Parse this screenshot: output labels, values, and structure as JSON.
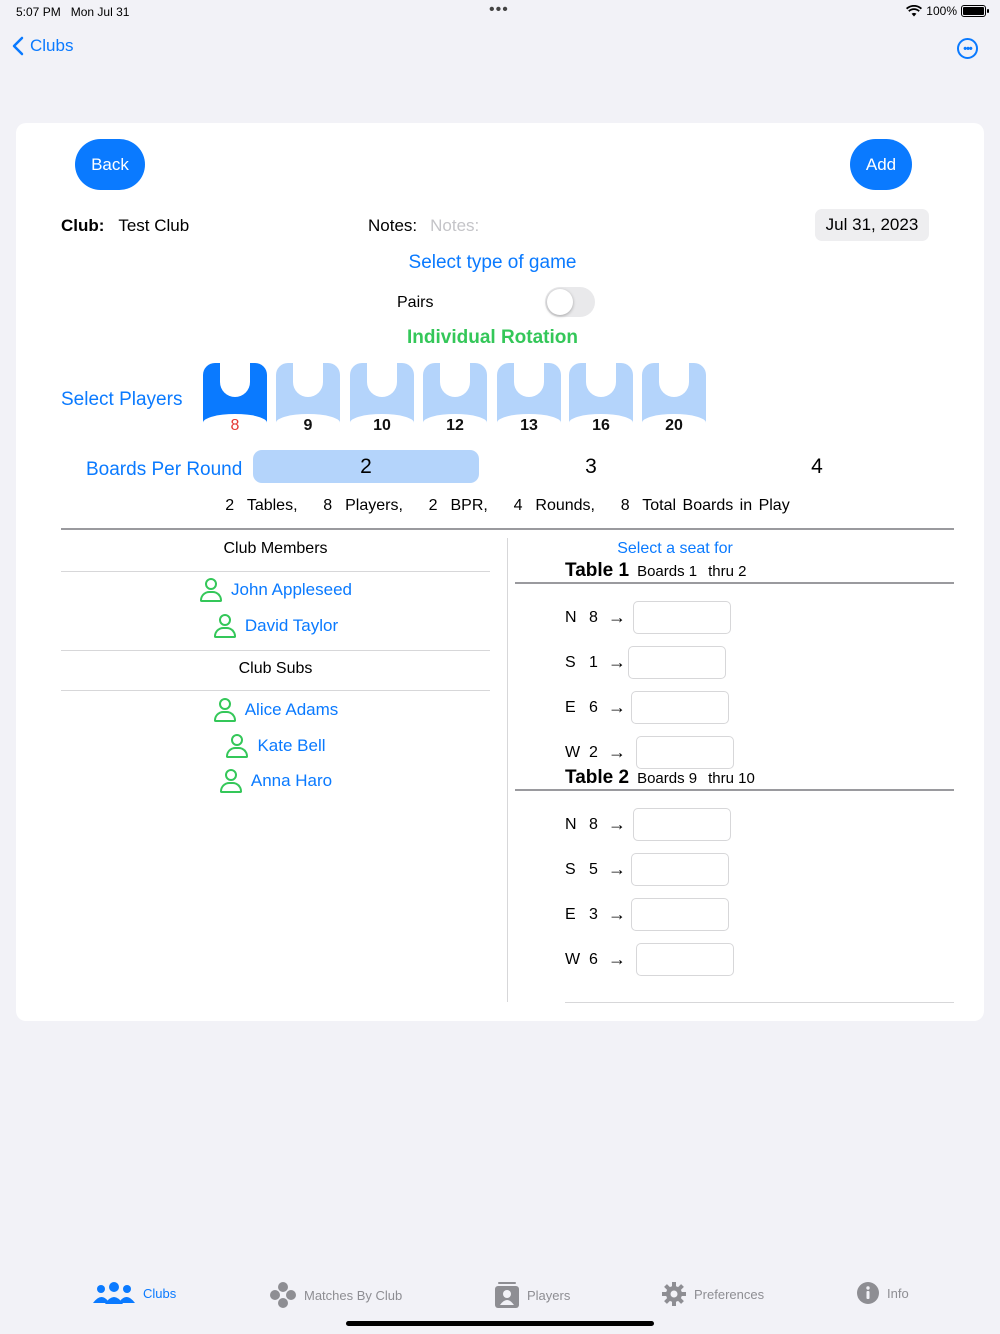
{
  "status": {
    "time": "5:07 PM",
    "date": "Mon Jul 31",
    "battery": "100%"
  },
  "nav": {
    "back_label": "Clubs"
  },
  "header": {
    "back_button": "Back",
    "add_button": "Add",
    "club_label": "Club:",
    "club_name": "Test Club",
    "notes_label": "Notes:",
    "notes_placeholder": "Notes:",
    "date": "Jul 31, 2023"
  },
  "game_type": {
    "title": "Select type of game",
    "pairs_label": "Pairs",
    "pairs_enabled": false,
    "mode": "Individual Rotation"
  },
  "players": {
    "label": "Select Players",
    "options": [
      "8",
      "9",
      "10",
      "12",
      "13",
      "16",
      "20"
    ],
    "selected": "8"
  },
  "boards_per_round": {
    "label": "Boards Per Round",
    "options": [
      "2",
      "3",
      "4"
    ],
    "selected": "2"
  },
  "summary": {
    "tables_num": "2",
    "tables_label": "Tables,",
    "players_num": "8",
    "players_label": "Players,",
    "bpr_num": "2",
    "bpr_label": "BPR,",
    "rounds_num": "4",
    "rounds_label": "Rounds,",
    "total_num": "8",
    "total_label": "Total Boards in Play"
  },
  "members": {
    "title": "Club Members",
    "list": [
      "John Appleseed",
      "David Taylor"
    ]
  },
  "subs": {
    "title": "Club Subs",
    "list": [
      "Alice  Adams",
      "Kate Bell",
      "Anna Haro"
    ]
  },
  "seats": {
    "title": "Select a seat for",
    "tables": [
      {
        "name": "Table 1",
        "boards_label": "Boards 1",
        "thru_label": "thru 2",
        "seats": [
          {
            "dir": "N",
            "player": "8"
          },
          {
            "dir": "S",
            "player": "1"
          },
          {
            "dir": "E",
            "player": "6"
          },
          {
            "dir": "W",
            "player": "2"
          }
        ]
      },
      {
        "name": "Table 2",
        "boards_label": "Boards 9",
        "thru_label": "thru 10",
        "seats": [
          {
            "dir": "N",
            "player": "8"
          },
          {
            "dir": "S",
            "player": "5"
          },
          {
            "dir": "E",
            "player": "3"
          },
          {
            "dir": "W",
            "player": "6"
          }
        ]
      }
    ],
    "arrow": "→"
  },
  "tabbar": {
    "items": [
      {
        "label": "Clubs",
        "icon": "people-group-icon"
      },
      {
        "label": "Matches By Club",
        "icon": "gamecontroller-icon"
      },
      {
        "label": "Players",
        "icon": "person-card-icon"
      },
      {
        "label": "Preferences",
        "icon": "gear-icon"
      },
      {
        "label": "Info",
        "icon": "info-icon"
      }
    ],
    "active": "Clubs"
  },
  "colors": {
    "accent": "#0a7aff",
    "selected_light": "#b4d4fb",
    "green": "#34c759",
    "red": "#e53935"
  }
}
